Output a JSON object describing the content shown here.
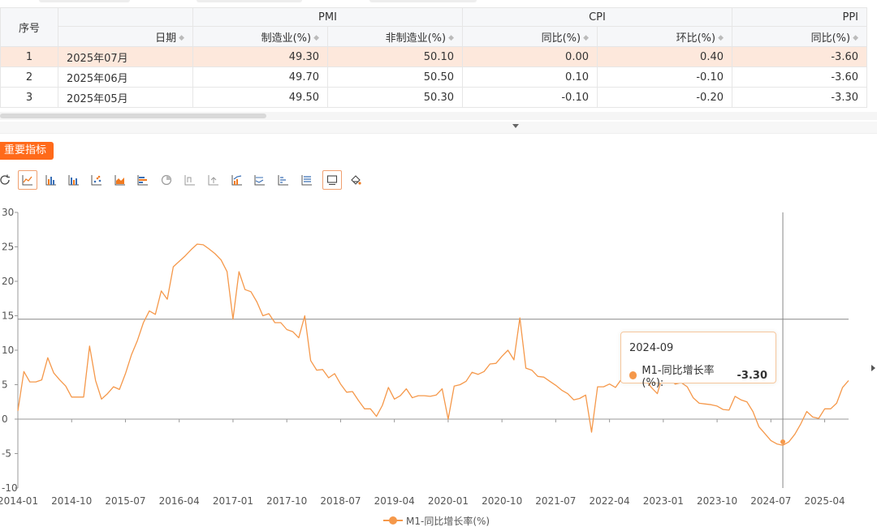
{
  "table": {
    "group_headers": [
      "序号",
      "PMI",
      "CPI",
      "PPI"
    ],
    "columns": [
      "日期",
      "制造业(%)",
      "非制造业(%)",
      "同比(%)",
      "环比(%)",
      "同比(%)"
    ],
    "rows": [
      {
        "idx": "1",
        "date": "2025年07月",
        "pmi_mfg": "49.30",
        "pmi_non": "50.10",
        "cpi_yoy": "0.00",
        "cpi_mom": "0.40",
        "ppi_yoy": "-3.60"
      },
      {
        "idx": "2",
        "date": "2025年06月",
        "pmi_mfg": "49.70",
        "pmi_non": "50.50",
        "cpi_yoy": "0.10",
        "cpi_mom": "-0.10",
        "ppi_yoy": "-3.60"
      },
      {
        "idx": "3",
        "date": "2025年05月",
        "pmi_mfg": "49.50",
        "pmi_non": "50.30",
        "cpi_yoy": "-0.10",
        "cpi_mom": "-0.20",
        "ppi_yoy": "-3.30"
      }
    ],
    "highlight_color": "#fde8dc"
  },
  "section_badge": "重要指标",
  "toolbar_icons": [
    "refresh-icon",
    "line-chart-icon",
    "bar-chart-icon",
    "grouped-bar-icon",
    "scatter-icon",
    "area-chart-icon",
    "horizontal-bar-icon",
    "pie-chart-icon",
    "step-icon",
    "stack-icon",
    "combo-icon",
    "horizontal-line-icon",
    "horizontal-step-icon",
    "list-icon",
    "data-view-icon",
    "clear-icon"
  ],
  "tooltip": {
    "date": "2024-09",
    "series": "M1-同比增长率(%):",
    "value": "-3.30"
  },
  "accent": "#f5984a",
  "chart_data": {
    "type": "line",
    "title": "",
    "xlabel": "",
    "ylabel": "",
    "ylim": [
      -10,
      30
    ],
    "yticks": [
      "30",
      "25",
      "20",
      "15",
      "10",
      "5",
      "0",
      "-5",
      "-10"
    ],
    "xticks": [
      "2014-01",
      "2014-10",
      "2015-07",
      "2016-04",
      "2017-01",
      "2017-10",
      "2018-07",
      "2019-04",
      "2020-01",
      "2020-10",
      "2021-07",
      "2022-04",
      "2023-01",
      "2023-10",
      "2024-07",
      "2025-04"
    ],
    "start": "2014-01",
    "series": [
      {
        "name": "M1-同比增长率(%)",
        "color": "#f5984a",
        "values": [
          1.2,
          6.9,
          5.4,
          5.4,
          5.7,
          8.9,
          6.7,
          5.7,
          4.8,
          3.2,
          3.2,
          3.2,
          10.6,
          5.6,
          2.9,
          3.7,
          4.7,
          4.3,
          6.6,
          9.3,
          11.4,
          14.0,
          15.7,
          15.2,
          18.6,
          17.4,
          22.1,
          22.9,
          23.7,
          24.6,
          25.4,
          25.3,
          24.7,
          24.0,
          23.1,
          21.4,
          14.5,
          21.4,
          18.8,
          18.5,
          17.0,
          15.0,
          15.3,
          14.0,
          14.0,
          13.0,
          12.7,
          11.8,
          15.0,
          8.5,
          7.1,
          7.2,
          6.0,
          6.6,
          5.1,
          3.9,
          4.0,
          2.7,
          1.5,
          1.5,
          0.4,
          2.0,
          4.6,
          2.9,
          3.4,
          4.4,
          3.1,
          3.4,
          3.4,
          3.3,
          3.5,
          4.4,
          0.0,
          4.8,
          5.0,
          5.5,
          6.8,
          6.5,
          6.9,
          8.0,
          8.1,
          9.1,
          10.0,
          8.6,
          14.7,
          7.4,
          7.1,
          6.2,
          6.1,
          5.5,
          4.9,
          4.2,
          3.7,
          2.8,
          3.0,
          3.5,
          -1.9,
          4.7,
          4.7,
          5.1,
          4.6,
          5.8,
          6.7,
          6.1,
          6.4,
          5.8,
          4.6,
          3.7,
          6.7,
          5.8,
          5.1,
          5.3,
          4.7,
          3.1,
          2.3,
          2.2,
          2.1,
          1.9,
          1.4,
          1.3,
          3.3,
          2.8,
          2.5,
          1.1,
          -1.1,
          -2.1,
          -3.1,
          -3.6,
          -3.8,
          -3.3,
          -2.2,
          -0.7,
          1.1,
          0.3,
          0.1,
          1.5,
          1.5,
          2.3,
          4.6,
          5.6
        ]
      }
    ],
    "crosshair": {
      "x": "2024-09",
      "y": 14.5
    },
    "highlight": {
      "x": "2024-09",
      "y": -3.3
    },
    "grid": false,
    "legend_position": "bottom-center"
  }
}
